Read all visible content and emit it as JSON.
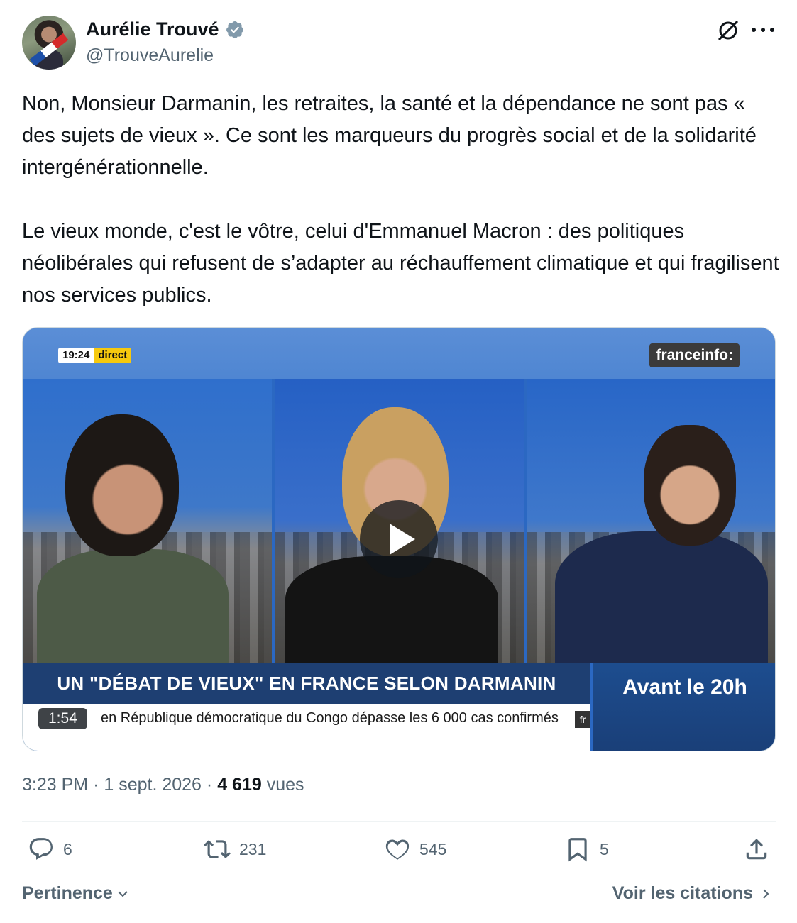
{
  "author": {
    "display_name": "Aurélie Trouvé",
    "handle": "@TrouveAurelie",
    "verified": true
  },
  "tweet": {
    "paragraphs": [
      "Non, Monsieur Darmanin, les retraites, la santé et la dépendance ne sont pas « des sujets de vieux ». Ce sont les marqueurs du progrès social et de la solidarité intergénérationnelle.",
      "Le vieux monde, c'est le vôtre, celui d'Emmanuel Macron : des politiques néolibérales qui refusent de s’adapter au réchauffement climatique et qui fragilisent nos services publics."
    ]
  },
  "video": {
    "clock_time": "19:24",
    "clock_label": "direct",
    "channel": "franceinfo:",
    "banner": "UN \"DÉBAT DE VIEUX\" EN FRANCE SELON DARMANIN",
    "ticker": "en République démocratique du Congo dépasse les 6 000 cas confirmés",
    "ticker_tag": "fr",
    "side_box": "Avant le 20h",
    "duration": "1:54"
  },
  "meta": {
    "time": "3:23 PM",
    "date": "1 sept. 2026",
    "separator": "·",
    "views_count": "4 619",
    "views_label": "vues"
  },
  "actions": {
    "replies": "6",
    "reposts": "231",
    "likes": "545",
    "bookmarks": "5"
  },
  "footer": {
    "sort_label": "Pertinence",
    "quotes_label": "Voir les citations"
  },
  "colors": {
    "text": "#0f1419",
    "secondary": "#536471",
    "verified_badge": "#829aab",
    "banner": "#1e3f72",
    "direct_badge": "#f6c90e"
  },
  "icons": [
    "verified-icon",
    "grok-icon",
    "more-icon",
    "play-icon",
    "reply-icon",
    "retweet-icon",
    "like-icon",
    "bookmark-icon",
    "share-icon",
    "chevron-down-icon",
    "chevron-right-icon"
  ]
}
